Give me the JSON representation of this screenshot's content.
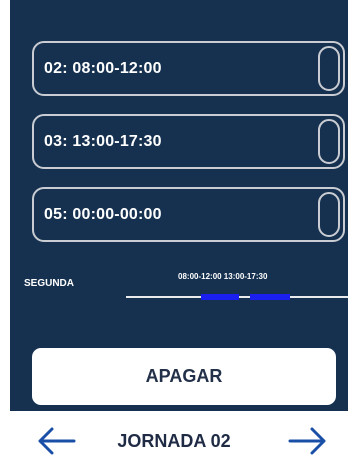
{
  "slots": [
    {
      "label": "02: 08:00-12:00"
    },
    {
      "label": "03: 13:00-17:30"
    },
    {
      "label": "05: 00:00-00:00"
    }
  ],
  "timeline": {
    "day_label": "SEGUNDA",
    "ranges_text": "08:00-12:00 13:00-17:30",
    "ranges": [
      {
        "start": "08:00",
        "end": "12:00"
      },
      {
        "start": "13:00",
        "end": "17:30"
      }
    ],
    "segment_color": "#1a1ff0"
  },
  "buttons": {
    "off_label": "APAGAR"
  },
  "footer": {
    "title": "JORNADA 02",
    "prev_icon": "arrow-left-icon",
    "next_icon": "arrow-right-icon"
  },
  "colors": {
    "background": "#16314f",
    "accent_blue": "#1a1ff0",
    "nav_arrow": "#1a4fa8"
  }
}
